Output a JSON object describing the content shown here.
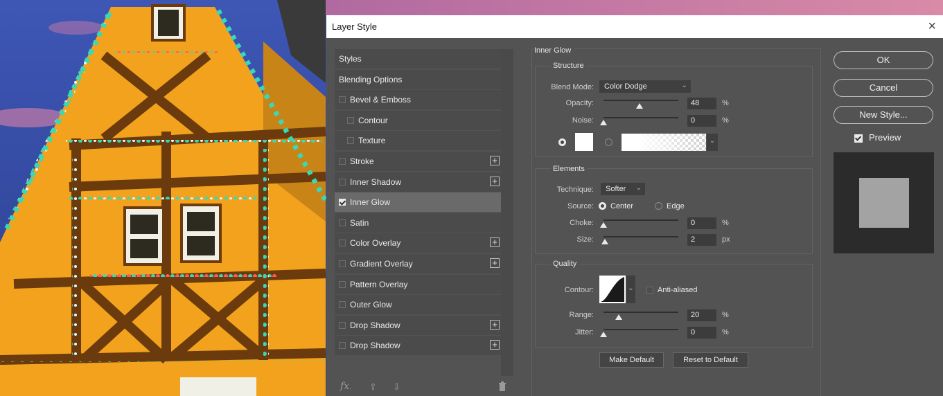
{
  "dialog": {
    "title": "Layer Style",
    "close_glyph": "×"
  },
  "styles_list": {
    "items": [
      {
        "label": "Styles",
        "checkbox": null,
        "plus": false,
        "selected": false,
        "indent": 0
      },
      {
        "label": "Blending Options",
        "checkbox": null,
        "plus": false,
        "selected": false,
        "indent": 0
      },
      {
        "label": "Bevel & Emboss",
        "checkbox": false,
        "plus": false,
        "selected": false,
        "indent": 0
      },
      {
        "label": "Contour",
        "checkbox": false,
        "plus": false,
        "selected": false,
        "indent": 1
      },
      {
        "label": "Texture",
        "checkbox": false,
        "plus": false,
        "selected": false,
        "indent": 1
      },
      {
        "label": "Stroke",
        "checkbox": false,
        "plus": true,
        "selected": false,
        "indent": 0
      },
      {
        "label": "Inner Shadow",
        "checkbox": false,
        "plus": true,
        "selected": false,
        "indent": 0
      },
      {
        "label": "Inner Glow",
        "checkbox": true,
        "plus": false,
        "selected": true,
        "indent": 0
      },
      {
        "label": "Satin",
        "checkbox": false,
        "plus": false,
        "selected": false,
        "indent": 0
      },
      {
        "label": "Color Overlay",
        "checkbox": false,
        "plus": true,
        "selected": false,
        "indent": 0
      },
      {
        "label": "Gradient Overlay",
        "checkbox": false,
        "plus": true,
        "selected": false,
        "indent": 0
      },
      {
        "label": "Pattern Overlay",
        "checkbox": false,
        "plus": false,
        "selected": false,
        "indent": 0
      },
      {
        "label": "Outer Glow",
        "checkbox": false,
        "plus": false,
        "selected": false,
        "indent": 0
      },
      {
        "label": "Drop Shadow",
        "checkbox": false,
        "plus": true,
        "selected": false,
        "indent": 0
      },
      {
        "label": "Drop Shadow",
        "checkbox": false,
        "plus": true,
        "selected": false,
        "indent": 0
      }
    ],
    "fx_label": "fx",
    "fx_suffix": ".",
    "up_glyph": "⇧",
    "down_glyph": "⇩",
    "trash_glyph": "🗑"
  },
  "inner_glow": {
    "section_title": "Inner Glow",
    "structure": {
      "title": "Structure",
      "blend_mode_label": "Blend Mode:",
      "blend_mode_value": "Color Dodge",
      "opacity_label": "Opacity:",
      "opacity_value": "48",
      "opacity_unit": "%",
      "opacity_fraction": 0.48,
      "noise_label": "Noise:",
      "noise_value": "0",
      "noise_unit": "%",
      "noise_fraction": 0.0,
      "glow_color": "#ffffff"
    },
    "elements": {
      "title": "Elements",
      "technique_label": "Technique:",
      "technique_value": "Softer",
      "source_label": "Source:",
      "source_center": "Center",
      "source_edge": "Edge",
      "choke_label": "Choke:",
      "choke_value": "0",
      "choke_unit": "%",
      "choke_fraction": 0.0,
      "size_label": "Size:",
      "size_value": "2",
      "size_unit": "px",
      "size_fraction": 0.02
    },
    "quality": {
      "title": "Quality",
      "contour_label": "Contour:",
      "anti_aliased_label": "Anti-aliased",
      "range_label": "Range:",
      "range_value": "20",
      "range_unit": "%",
      "range_fraction": 0.2,
      "jitter_label": "Jitter:",
      "jitter_value": "0",
      "jitter_unit": "%",
      "jitter_fraction": 0.0
    },
    "make_default_label": "Make Default",
    "reset_default_label": "Reset to Default"
  },
  "actions": {
    "ok_label": "OK",
    "cancel_label": "Cancel",
    "new_style_label": "New Style...",
    "preview_label": "Preview",
    "preview_checked": true
  },
  "icons": {
    "close": "close-icon",
    "add": "plus-icon",
    "fx": "fx-icon",
    "up": "arrow-up-icon",
    "down": "arrow-down-icon",
    "trash": "trash-icon",
    "chevron": "chevron-down-icon"
  }
}
